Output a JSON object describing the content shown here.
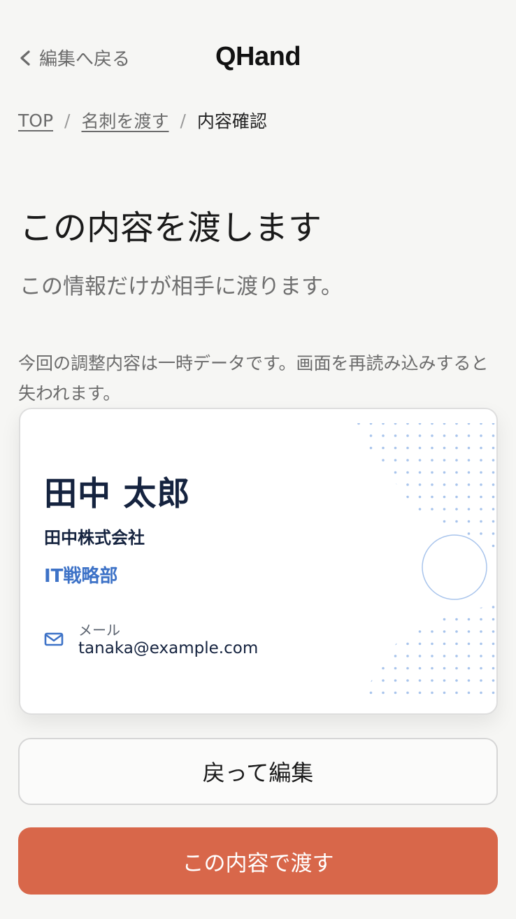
{
  "header": {
    "back_label": "編集へ戻る",
    "brand": "QHand"
  },
  "breadcrumb": {
    "items": [
      "TOP",
      "名刺を渡す"
    ],
    "separator": "/",
    "current": "内容確認"
  },
  "main": {
    "title": "この内容を渡します",
    "subtitle": "この情報だけが相手に渡ります。",
    "notice": "今回の調整内容は一時データです。画面を再読み込みすると失われます。"
  },
  "card": {
    "name": "田中 太郎",
    "company": "田中株式会社",
    "department": "IT戦略部",
    "email_label": "メール",
    "email": "tanaka@example.com"
  },
  "actions": {
    "edit_label": "戻って編集",
    "submit_label": "この内容で渡す"
  },
  "colors": {
    "background": "#f6f6f4",
    "accent": "#d8674a",
    "navy": "#15233f",
    "blue": "#3d72c7"
  },
  "icons": [
    "chevron-left-icon",
    "mail-icon"
  ]
}
